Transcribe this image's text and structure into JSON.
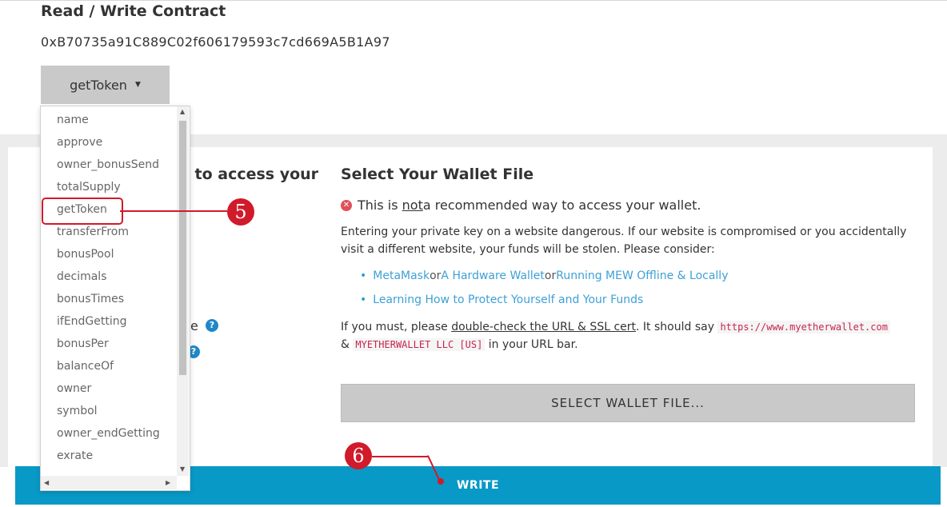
{
  "contract": {
    "title": "Read / Write Contract",
    "address": "0xB70735a91C889C02f606179593c7cd669A5B1A97",
    "selected_function": "getToken"
  },
  "function_list": [
    "name",
    "approve",
    "owner_bonusSend",
    "totalSupply",
    "getToken",
    "transferFrom",
    "bonusPool",
    "decimals",
    "bonusTimes",
    "ifEndGetting",
    "bonusPer",
    "balanceOf",
    "owner",
    "symbol",
    "owner_endGetting",
    "exrate"
  ],
  "left_panel": {
    "heading_fragment": "e to access your",
    "line_fragment": "e",
    "help_icon": "question-circle-icon"
  },
  "wallet": {
    "title": "Select Your Wallet File",
    "warning_pre": "This is ",
    "warning_not": "not",
    "warning_post": " a recommended way to access your wallet.",
    "paragraph": "Entering your private key on a website dangerous. If our website is compromised or you accidentally visit a different website, your funds will be stolen. Please consider:",
    "link_metamask": "MetaMask",
    "or1": " or ",
    "link_hardware": "A Hardware Wallet",
    "or2": " or ",
    "link_offline": "Running MEW Offline & Locally",
    "link_learning": "Learning How to Protect Yourself and Your Funds",
    "must_pre": "If you must, please ",
    "must_link": "double-check the URL & SSL cert",
    "must_mid": ". It should say ",
    "url_code": "https://www.myetherwallet.com",
    "amp": "&",
    "company_code": "MYETHERWALLET LLC [US]",
    "must_post": " in your URL bar.",
    "select_button": "SELECT WALLET FILE..."
  },
  "write_button": "WRITE",
  "annotations": {
    "step5": "5",
    "step6": "6",
    "color": "#d11a2a"
  },
  "colors": {
    "accent": "#0899c6",
    "link": "#3ea0d6",
    "button_gray": "#c9c9c9"
  }
}
